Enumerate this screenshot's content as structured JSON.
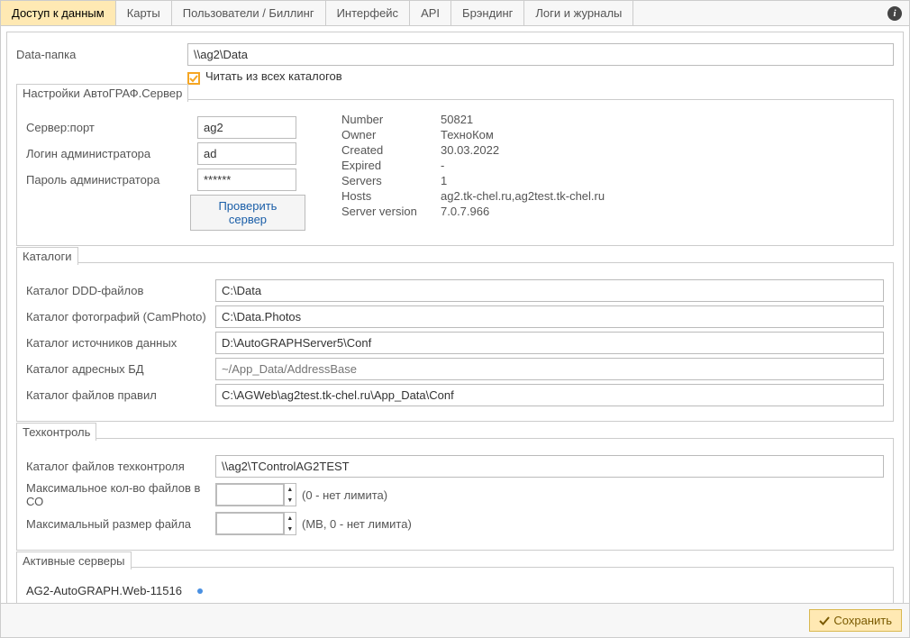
{
  "tabs": [
    "Доступ к данным",
    "Карты",
    "Пользователи / Биллинг",
    "Интерфейс",
    "API",
    "Брэндинг",
    "Логи и журналы"
  ],
  "active_tab": 0,
  "data_folder": {
    "label": "Data-папка",
    "value": "\\\\ag2\\Data",
    "read_all_label": "Читать из всех каталогов",
    "read_all_checked": true
  },
  "server_settings": {
    "legend": "Настройки АвтоГРАФ.Сервер",
    "server_port_label": "Сервер:порт",
    "server_port_value": "ag2",
    "admin_login_label": "Логин администратора",
    "admin_login_value": "ad",
    "admin_pass_label": "Пароль администратора",
    "admin_pass_value": "******",
    "check_button": "Проверить сервер",
    "info": {
      "number_label": "Number",
      "number_value": "50821",
      "owner_label": "Owner",
      "owner_value": "ТехноКом",
      "created_label": "Created",
      "created_value": "30.03.2022",
      "expired_label": "Expired",
      "expired_value": "-",
      "servers_label": "Servers",
      "servers_value": "1",
      "hosts_label": "Hosts",
      "hosts_value": "ag2.tk-chel.ru,ag2test.tk-chel.ru",
      "sv_label": "Server version",
      "sv_value": "7.0.7.966"
    }
  },
  "catalogs": {
    "legend": "Каталоги",
    "ddd_label": "Каталог DDD-файлов",
    "ddd_value": "C:\\Data",
    "photo_label": "Каталог фотографий (CamPhoto)",
    "photo_value": "C:\\Data.Photos",
    "datasrc_label": "Каталог источников данных",
    "datasrc_value": "D:\\AutoGRAPHServer5\\Conf",
    "addr_label": "Каталог адресных БД",
    "addr_placeholder": "~/App_Data/AddressBase",
    "rules_label": "Каталог файлов правил",
    "rules_value": "C:\\AGWeb\\ag2test.tk-chel.ru\\App_Data\\Conf"
  },
  "tech": {
    "legend": "Техконтроль",
    "dir_label": "Каталог файлов техконтроля",
    "dir_value": "\\\\ag2\\TControlAG2TEST",
    "max_files_label": "Максимальное кол-во файлов в СО",
    "max_files_value": "",
    "max_files_hint": "(0 - нет лимита)",
    "max_size_label": "Максимальный размер файла",
    "max_size_value": "",
    "max_size_hint": "(MB, 0 - нет лимита)"
  },
  "active_servers": {
    "legend": "Активные серверы",
    "items": [
      {
        "name": "AG2-AutoGRAPH.Web-11516"
      }
    ]
  },
  "save_label": "Сохранить"
}
